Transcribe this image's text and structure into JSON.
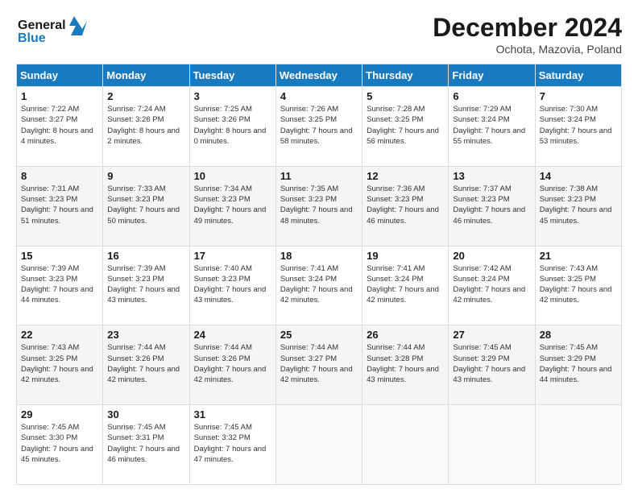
{
  "header": {
    "logo_line1": "General",
    "logo_line2": "Blue",
    "month": "December 2024",
    "location": "Ochota, Mazovia, Poland"
  },
  "weekdays": [
    "Sunday",
    "Monday",
    "Tuesday",
    "Wednesday",
    "Thursday",
    "Friday",
    "Saturday"
  ],
  "weeks": [
    [
      {
        "day": "1",
        "sunrise": "7:22 AM",
        "sunset": "3:27 PM",
        "daylight": "8 hours and 4 minutes."
      },
      {
        "day": "2",
        "sunrise": "7:24 AM",
        "sunset": "3:26 PM",
        "daylight": "8 hours and 2 minutes."
      },
      {
        "day": "3",
        "sunrise": "7:25 AM",
        "sunset": "3:26 PM",
        "daylight": "8 hours and 0 minutes."
      },
      {
        "day": "4",
        "sunrise": "7:26 AM",
        "sunset": "3:25 PM",
        "daylight": "7 hours and 58 minutes."
      },
      {
        "day": "5",
        "sunrise": "7:28 AM",
        "sunset": "3:25 PM",
        "daylight": "7 hours and 56 minutes."
      },
      {
        "day": "6",
        "sunrise": "7:29 AM",
        "sunset": "3:24 PM",
        "daylight": "7 hours and 55 minutes."
      },
      {
        "day": "7",
        "sunrise": "7:30 AM",
        "sunset": "3:24 PM",
        "daylight": "7 hours and 53 minutes."
      }
    ],
    [
      {
        "day": "8",
        "sunrise": "7:31 AM",
        "sunset": "3:23 PM",
        "daylight": "7 hours and 51 minutes."
      },
      {
        "day": "9",
        "sunrise": "7:33 AM",
        "sunset": "3:23 PM",
        "daylight": "7 hours and 50 minutes."
      },
      {
        "day": "10",
        "sunrise": "7:34 AM",
        "sunset": "3:23 PM",
        "daylight": "7 hours and 49 minutes."
      },
      {
        "day": "11",
        "sunrise": "7:35 AM",
        "sunset": "3:23 PM",
        "daylight": "7 hours and 48 minutes."
      },
      {
        "day": "12",
        "sunrise": "7:36 AM",
        "sunset": "3:23 PM",
        "daylight": "7 hours and 46 minutes."
      },
      {
        "day": "13",
        "sunrise": "7:37 AM",
        "sunset": "3:23 PM",
        "daylight": "7 hours and 46 minutes."
      },
      {
        "day": "14",
        "sunrise": "7:38 AM",
        "sunset": "3:23 PM",
        "daylight": "7 hours and 45 minutes."
      }
    ],
    [
      {
        "day": "15",
        "sunrise": "7:39 AM",
        "sunset": "3:23 PM",
        "daylight": "7 hours and 44 minutes."
      },
      {
        "day": "16",
        "sunrise": "7:39 AM",
        "sunset": "3:23 PM",
        "daylight": "7 hours and 43 minutes."
      },
      {
        "day": "17",
        "sunrise": "7:40 AM",
        "sunset": "3:23 PM",
        "daylight": "7 hours and 43 minutes."
      },
      {
        "day": "18",
        "sunrise": "7:41 AM",
        "sunset": "3:24 PM",
        "daylight": "7 hours and 42 minutes."
      },
      {
        "day": "19",
        "sunrise": "7:41 AM",
        "sunset": "3:24 PM",
        "daylight": "7 hours and 42 minutes."
      },
      {
        "day": "20",
        "sunrise": "7:42 AM",
        "sunset": "3:24 PM",
        "daylight": "7 hours and 42 minutes."
      },
      {
        "day": "21",
        "sunrise": "7:43 AM",
        "sunset": "3:25 PM",
        "daylight": "7 hours and 42 minutes."
      }
    ],
    [
      {
        "day": "22",
        "sunrise": "7:43 AM",
        "sunset": "3:25 PM",
        "daylight": "7 hours and 42 minutes."
      },
      {
        "day": "23",
        "sunrise": "7:44 AM",
        "sunset": "3:26 PM",
        "daylight": "7 hours and 42 minutes."
      },
      {
        "day": "24",
        "sunrise": "7:44 AM",
        "sunset": "3:26 PM",
        "daylight": "7 hours and 42 minutes."
      },
      {
        "day": "25",
        "sunrise": "7:44 AM",
        "sunset": "3:27 PM",
        "daylight": "7 hours and 42 minutes."
      },
      {
        "day": "26",
        "sunrise": "7:44 AM",
        "sunset": "3:28 PM",
        "daylight": "7 hours and 43 minutes."
      },
      {
        "day": "27",
        "sunrise": "7:45 AM",
        "sunset": "3:29 PM",
        "daylight": "7 hours and 43 minutes."
      },
      {
        "day": "28",
        "sunrise": "7:45 AM",
        "sunset": "3:29 PM",
        "daylight": "7 hours and 44 minutes."
      }
    ],
    [
      {
        "day": "29",
        "sunrise": "7:45 AM",
        "sunset": "3:30 PM",
        "daylight": "7 hours and 45 minutes."
      },
      {
        "day": "30",
        "sunrise": "7:45 AM",
        "sunset": "3:31 PM",
        "daylight": "7 hours and 46 minutes."
      },
      {
        "day": "31",
        "sunrise": "7:45 AM",
        "sunset": "3:32 PM",
        "daylight": "7 hours and 47 minutes."
      },
      null,
      null,
      null,
      null
    ]
  ],
  "labels": {
    "sunrise": "Sunrise:",
    "sunset": "Sunset:",
    "daylight": "Daylight:"
  }
}
